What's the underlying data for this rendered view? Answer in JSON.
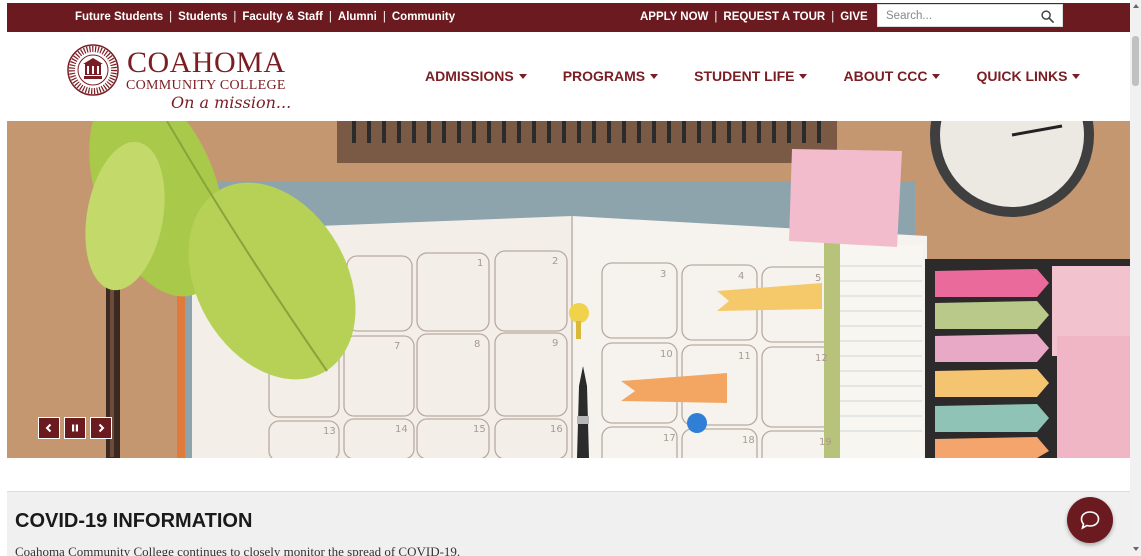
{
  "utility_nav": {
    "left_links": [
      "Future Students",
      "Students",
      "Faculty & Staff",
      "Alumni",
      "Community"
    ],
    "right_links": [
      "APPLY NOW",
      "REQUEST A TOUR",
      "GIVE"
    ],
    "separator": "|"
  },
  "search": {
    "placeholder": "Search..."
  },
  "logo": {
    "name": "COAHOMA",
    "subtitle": "COMMUNITY COLLEGE",
    "tagline": "On a mission..."
  },
  "main_nav": {
    "items": [
      {
        "label": "ADMISSIONS"
      },
      {
        "label": "PROGRAMS"
      },
      {
        "label": "STUDENT LIFE"
      },
      {
        "label": "ABOUT CCC"
      },
      {
        "label": "QUICK LINKS"
      }
    ]
  },
  "hero": {
    "image_description": "desk-calendar-planner",
    "calendar_numbers": [
      "1",
      "2",
      "3",
      "4",
      "5",
      "7",
      "8",
      "9",
      "10",
      "11",
      "12",
      "13",
      "14",
      "15",
      "16",
      "17",
      "18",
      "19"
    ],
    "controls": [
      "prev",
      "pause",
      "next"
    ]
  },
  "covid": {
    "title": "COVID-19 INFORMATION",
    "text": "Coahoma Community College continues to closely monitor the spread of COVID-19."
  },
  "colors": {
    "brand_maroon": "#6b1a1f",
    "text_maroon": "#7a1e24",
    "wood": "#c89a72"
  },
  "icons": {
    "search": "search-icon",
    "chat": "chat-icon",
    "prev": "chevron-left-icon",
    "pause": "pause-icon",
    "next": "chevron-right-icon"
  }
}
